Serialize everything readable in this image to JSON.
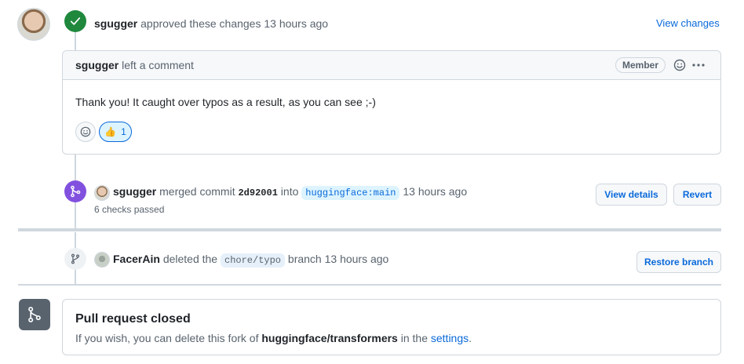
{
  "approval": {
    "user": "sgugger",
    "action": "approved these changes",
    "time": "13 hours ago",
    "view_changes": "View changes"
  },
  "comment": {
    "user": "sgugger",
    "action": "left a comment",
    "role_badge": "Member",
    "body": "Thank you! It caught over typos as a result, as you can see ;-)",
    "reaction_emoji": "👍",
    "reaction_count": "1"
  },
  "merge": {
    "user": "sgugger",
    "action": "merged commit",
    "commit": "2d92001",
    "into": "into",
    "target": "huggingface:main",
    "time": "13 hours ago",
    "checks": "6 checks passed",
    "view_details": "View details",
    "revert": "Revert"
  },
  "deletion": {
    "user": "FacerAin",
    "action": "deleted the",
    "branch": "chore/typo",
    "branch_word": "branch",
    "time": "13 hours ago",
    "restore": "Restore branch"
  },
  "closed": {
    "title": "Pull request closed",
    "text_prefix": "If you wish, you can delete this fork of",
    "repo": "huggingface/transformers",
    "text_mid": "in the",
    "settings_link": "settings",
    "text_suffix": "."
  },
  "colors": {
    "approved": "#1f883d",
    "merged": "#8250df",
    "link": "#0969da",
    "closed_icon_bg": "#59636e"
  },
  "icons": [
    "check-icon",
    "smiley-icon",
    "kebab-icon",
    "thumbs-up-icon",
    "merge-icon",
    "branch-icon"
  ]
}
